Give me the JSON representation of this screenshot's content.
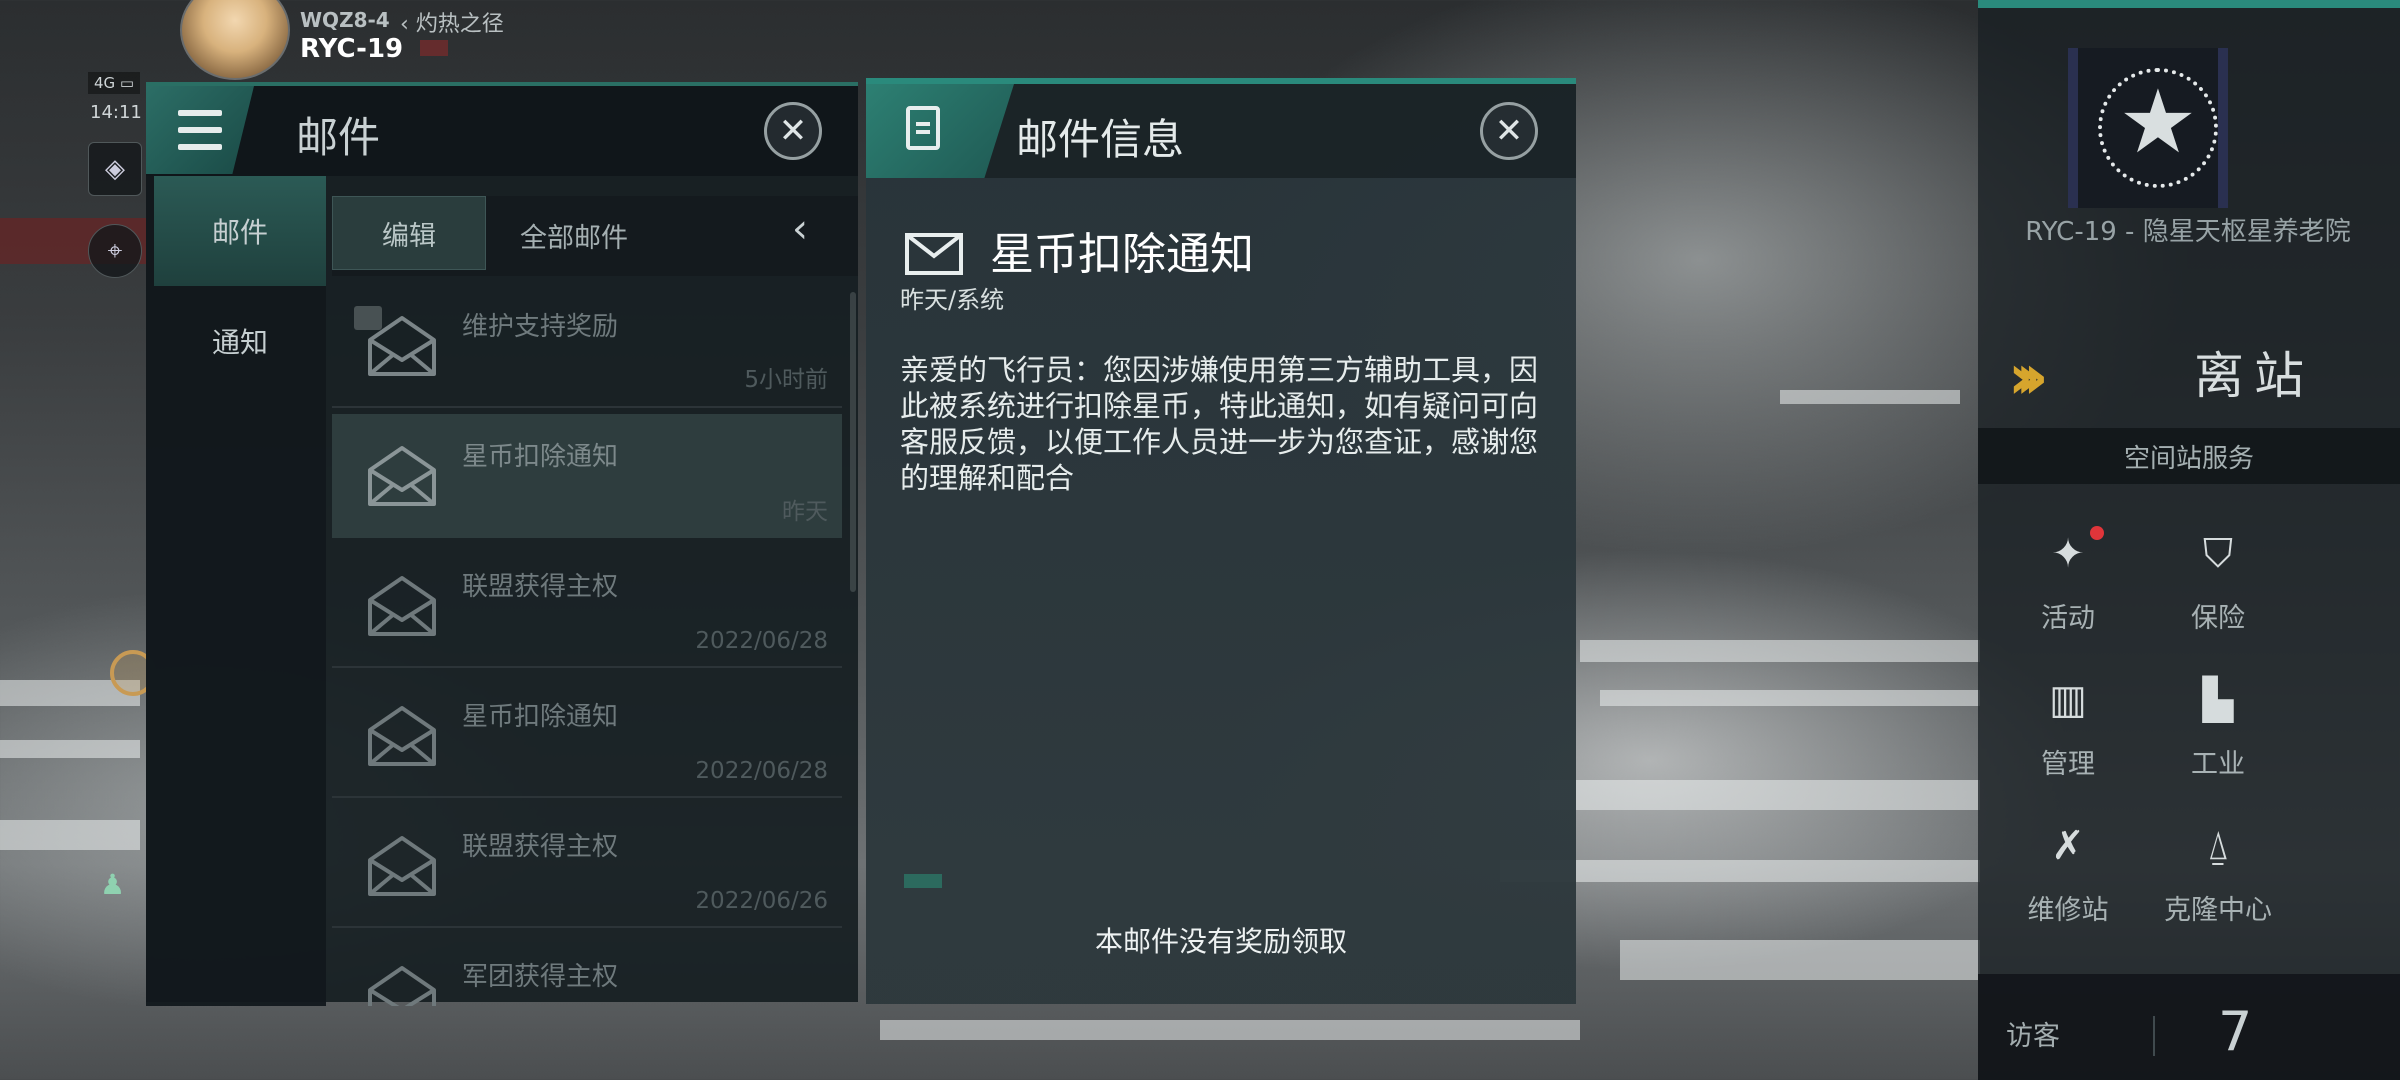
{
  "hud": {
    "pilot_code": "WQZ8-4",
    "route": "‹ 灼热之径",
    "system": "RYC-19",
    "signal": "4G ▭",
    "time": "14:11"
  },
  "mail_panel": {
    "title": "邮件",
    "tabs": [
      {
        "label": "邮件",
        "active": true
      },
      {
        "label": "通知",
        "active": false
      }
    ],
    "toolbar": {
      "edit_label": "编辑",
      "filter_label": "全部邮件"
    },
    "items": [
      {
        "subject": "维护支持奖励",
        "date": "5小时前"
      },
      {
        "subject": "星币扣除通知",
        "date": "昨天",
        "selected": true
      },
      {
        "subject": "联盟获得主权",
        "date": "2022/06/28"
      },
      {
        "subject": "星币扣除通知",
        "date": "2022/06/28"
      },
      {
        "subject": "联盟获得主权",
        "date": "2022/06/26"
      },
      {
        "subject": "军团获得主权",
        "date": ""
      }
    ]
  },
  "detail": {
    "header_title": "邮件信息",
    "subject": "星币扣除通知",
    "meta": "昨天/系统",
    "body": "亲爱的飞行员：您因涉嫌使用第三方辅助工具，因此被系统进行扣除星币，特此通知，如有疑问可向客服反馈，以便工作人员进一步为您查证，感谢您的理解和配合",
    "footer": "本邮件没有奖励领取"
  },
  "station": {
    "name": "RYC-19 - 隐星天枢星养老院",
    "undock_label": "离站",
    "services_title": "空间站服务",
    "services": [
      {
        "label": "活动",
        "icon": "party-popper-icon",
        "has_alert": true
      },
      {
        "label": "保险",
        "icon": "shield-icon",
        "has_alert": false
      },
      {
        "label": "管理",
        "icon": "management-icon",
        "has_alert": false
      },
      {
        "label": "工业",
        "icon": "factory-icon",
        "has_alert": false
      },
      {
        "label": "维修站",
        "icon": "wrench-icon",
        "has_alert": false
      },
      {
        "label": "克隆中心",
        "icon": "clone-icon",
        "has_alert": false
      }
    ],
    "visitor_label": "访客",
    "visitor_count": "7"
  },
  "colors": {
    "accent": "#2a8a7c",
    "undock_chevron": "#d6a52d",
    "alert": "#e0353a"
  }
}
